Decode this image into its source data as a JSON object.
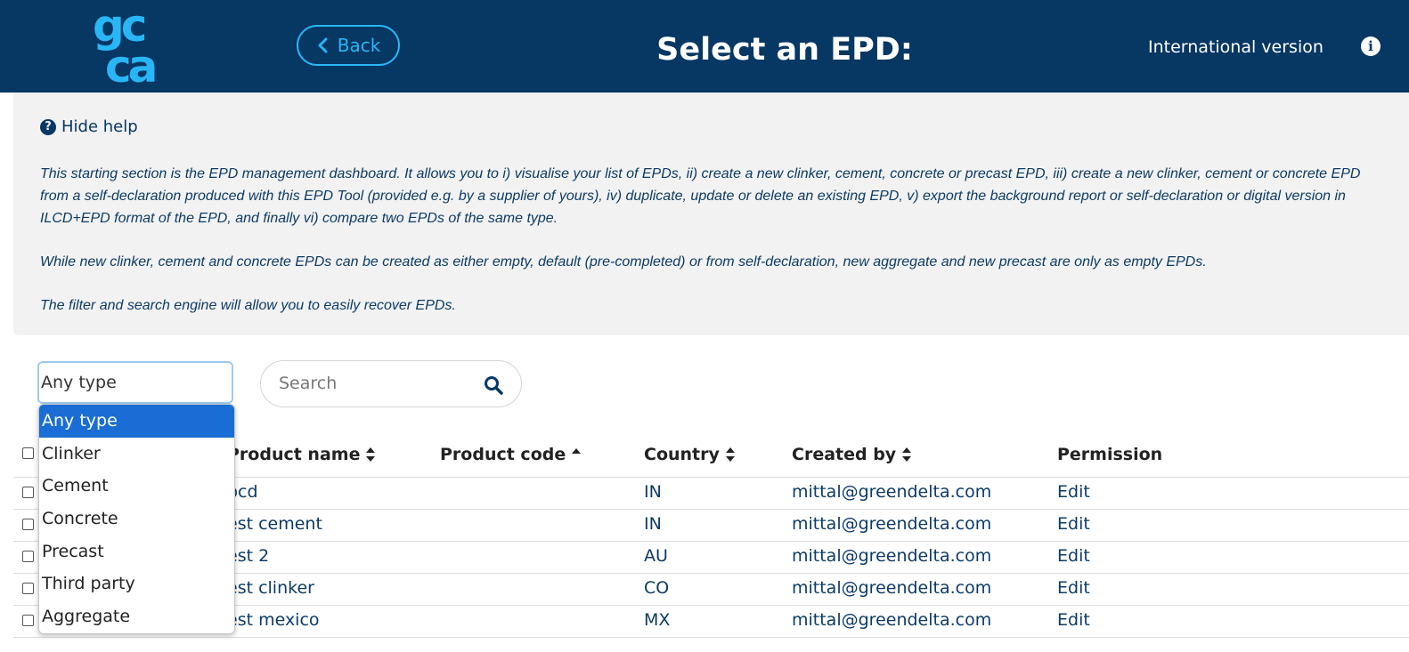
{
  "header": {
    "back_label": "Back",
    "title": "Select an EPD:",
    "version": "International version",
    "colors": {
      "background": "#073763",
      "accent": "#29b6f6"
    }
  },
  "help": {
    "toggle_label": "Hide help",
    "paragraph1": "This starting section is the EPD management dashboard. It allows you to i) visualise your list of EPDs, ii) create a new clinker, cement, concrete or precast EPD, iii) create a new clinker, cement or concrete EPD from a self-declaration produced with this EPD Tool (provided e.g. by a supplier of yours), iv) duplicate, update or delete an existing EPD, v) export the background report or self-declaration or digital version in ILCD+EPD format of the EPD, and finally vi) compare two EPDs of the same type.",
    "paragraph2": "While new clinker, cement and concrete EPDs can be created as either empty, default (pre-completed) or from self-declaration, new aggregate and new precast are only as empty EPDs.",
    "paragraph3": "The filter and search engine will allow you to easily recover EPDs."
  },
  "filters": {
    "type_value": "Any type",
    "type_options": [
      "Any type",
      "Clinker",
      "Cement",
      "Concrete",
      "Precast",
      "Third party",
      "Aggregate"
    ],
    "search_placeholder": "Search"
  },
  "table": {
    "headers": {
      "product_name": "Product name",
      "product_code": "Product code",
      "country": "Country",
      "created_by": "Created by",
      "permission": "Permission"
    },
    "rows": [
      {
        "name": "bcd",
        "code": "",
        "country": "IN",
        "created_by": "mittal@greendelta.com",
        "permission": "Edit"
      },
      {
        "name": "est cement",
        "code": "",
        "country": "IN",
        "created_by": "mittal@greendelta.com",
        "permission": "Edit"
      },
      {
        "name": "est 2",
        "code": "",
        "country": "AU",
        "created_by": "mittal@greendelta.com",
        "permission": "Edit"
      },
      {
        "name": "est clinker",
        "code": "",
        "country": "CO",
        "created_by": "mittal@greendelta.com",
        "permission": "Edit"
      },
      {
        "name": "est mexico",
        "code": "",
        "country": "MX",
        "created_by": "mittal@greendelta.com",
        "permission": "Edit"
      }
    ]
  }
}
